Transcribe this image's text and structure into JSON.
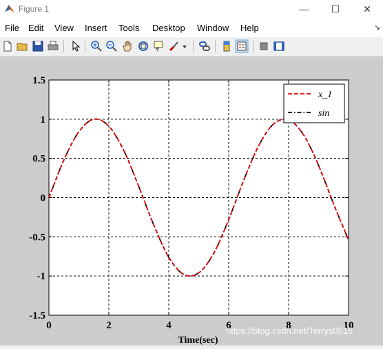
{
  "window": {
    "title": "Figure 1",
    "minimize_glyph": "—",
    "maximize_glyph": "☐",
    "close_glyph": "✕"
  },
  "menu": {
    "items": [
      "File",
      "Edit",
      "View",
      "Insert",
      "Tools",
      "Desktop",
      "Window",
      "Help"
    ],
    "overflow_glyph": "↘"
  },
  "toolbar": {
    "icons": [
      "new-figure-icon",
      "open-file-icon",
      "save-icon",
      "print-icon",
      "pointer-icon",
      "zoom-in-icon",
      "zoom-out-icon",
      "pan-icon",
      "rotate-icon",
      "data-cursor-icon",
      "brush-icon",
      "link-icon",
      "colorbar-icon",
      "legend-icon",
      "hide-plot-tools-icon",
      "show-plot-tools-icon"
    ]
  },
  "chart_data": {
    "type": "line",
    "xlabel": "Time(sec)",
    "ylabel": "",
    "title": "",
    "xlim": [
      0,
      10
    ],
    "ylim": [
      -1.5,
      1.5
    ],
    "x_ticks": [
      "0",
      "2",
      "4",
      "6",
      "8",
      "10"
    ],
    "y_ticks": [
      "1.5",
      "1",
      "0.5",
      "0",
      "-0.5",
      "-1",
      "-1.5"
    ],
    "grid": true,
    "legend_position": "top-right",
    "series": [
      {
        "name": "x_1",
        "style": "dashed",
        "color": "#e00000",
        "x": [
          0,
          0.5,
          1,
          1.5,
          2,
          2.5,
          3,
          3.5,
          4,
          4.5,
          5,
          5.5,
          6,
          6.5,
          7,
          7.5,
          8,
          8.5,
          9,
          9.5,
          10
        ],
        "y": [
          0,
          0.48,
          0.84,
          1.0,
          0.91,
          0.6,
          0.14,
          -0.35,
          -0.76,
          -0.98,
          -0.96,
          -0.71,
          -0.28,
          0.22,
          0.66,
          0.94,
          0.99,
          0.8,
          0.41,
          -0.08,
          -0.54
        ]
      },
      {
        "name": "sin",
        "style": "dash-dot",
        "color": "#000000",
        "x": [
          0,
          0.5,
          1,
          1.5,
          2,
          2.5,
          3,
          3.5,
          4,
          4.5,
          5,
          5.5,
          6,
          6.5,
          7,
          7.5,
          8,
          8.5,
          9,
          9.5,
          10
        ],
        "y": [
          0,
          0.48,
          0.84,
          1.0,
          0.91,
          0.6,
          0.14,
          -0.35,
          -0.76,
          -0.98,
          -0.96,
          -0.71,
          -0.28,
          0.22,
          0.66,
          0.94,
          0.99,
          0.8,
          0.41,
          -0.08,
          -0.54
        ]
      }
    ]
  },
  "watermark": "https://blog.csdn.net/Terrys0518"
}
